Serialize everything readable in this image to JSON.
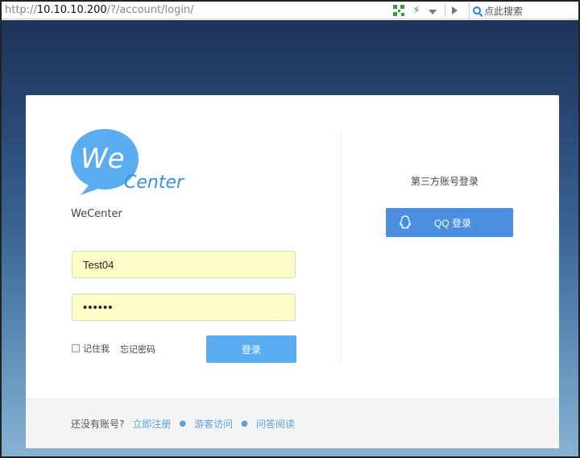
{
  "browser": {
    "url_prefix": "http://",
    "url_host": "10.10.10.200",
    "url_path": "/?/account/login/",
    "search_placeholder": "点此搜索"
  },
  "login": {
    "brand_name": "WeCenter",
    "logo_text_we": "We",
    "logo_text_center": "Center",
    "username_value": "Test04",
    "password_value": "••••••",
    "remember_label": "记住我",
    "forgot_label": "忘记密码",
    "login_button": "登录"
  },
  "third_party": {
    "title": "第三方账号登录",
    "qq_button": "QQ 登录"
  },
  "footer": {
    "prefix": "还没有账号?",
    "links": [
      "立即注册",
      "游客访问",
      "问答阅读"
    ]
  },
  "colors": {
    "accent": "#5aadf1",
    "qq": "#4a8ee0",
    "link": "#5aa2df",
    "input_bg": "#fbfcc6"
  },
  "icons": [
    "qr-code-icon",
    "lightning-icon",
    "dropdown-arrow-icon",
    "play-icon",
    "search-icon",
    "qq-penguin-icon"
  ]
}
